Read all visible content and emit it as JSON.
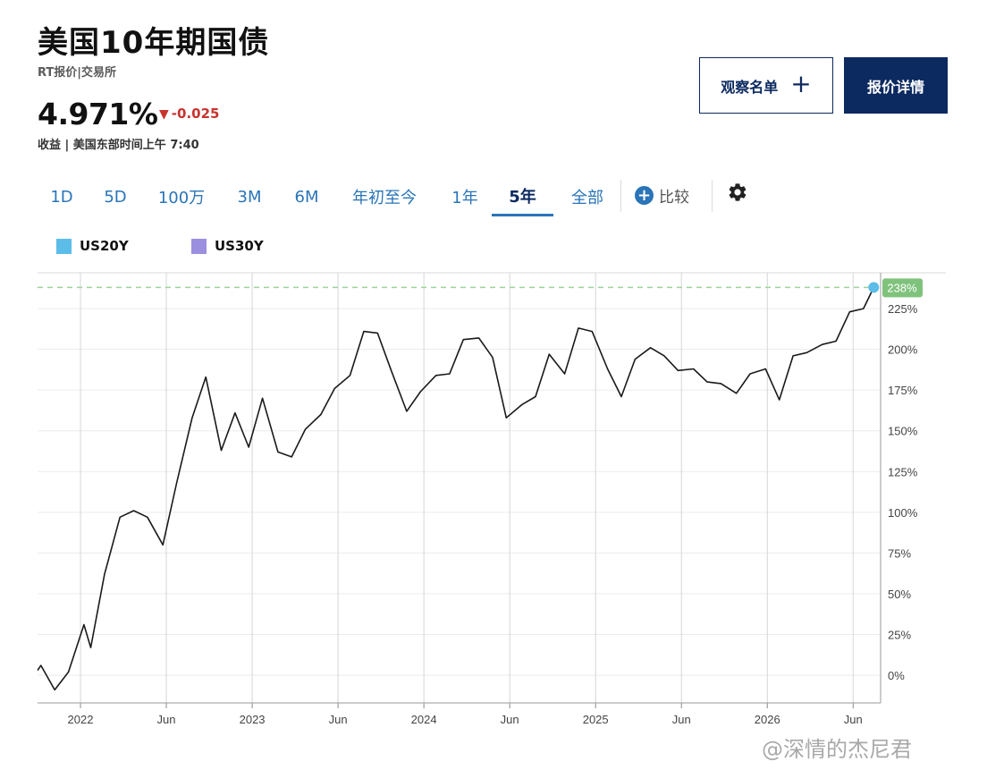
{
  "header": {
    "title": "美国10年期国债",
    "subtitle": "RT报价|交易所",
    "price": "4.971%",
    "change_arrow": "▼",
    "change": "-0.025",
    "yield_note": "收益 | 美国东部时间上午 7:40"
  },
  "buttons": {
    "watchlist_label": "观察名单",
    "watchlist_plus": "+",
    "quote_label": "报价详情"
  },
  "tabs": [
    {
      "label": "1D"
    },
    {
      "label": "5D"
    },
    {
      "label": "100万"
    },
    {
      "label": "3M"
    },
    {
      "label": "6M"
    },
    {
      "label": "年初至今"
    },
    {
      "label": "1年"
    },
    {
      "label": "5年"
    },
    {
      "label": "全部"
    }
  ],
  "active_tab": "5年",
  "compare": {
    "icon": "plus-circle-icon",
    "label": "比较"
  },
  "settings_icon": "gear-icon",
  "legend": [
    {
      "name": "US20Y",
      "color": "#5bbde8"
    },
    {
      "name": "US30Y",
      "color": "#9b8fe0"
    }
  ],
  "watermark": "@深情的杰尼君",
  "colors": {
    "line": "#1a1a1a",
    "last_badge": "#7fc27c",
    "last_dot": "#5bbde8",
    "dashed": "#9ed39a",
    "grid": "#ebebeb",
    "vgrid": "#d6d6d6",
    "tab_active": "#0c2a60",
    "tab": "#2a74b8",
    "down": "#c8332e"
  },
  "chart_data": {
    "type": "line",
    "xlabel": "",
    "ylabel": "",
    "x_range": [
      2021.75,
      2026.66
    ],
    "ylim": [
      -17,
      247
    ],
    "y_ticks": [
      0,
      25,
      50,
      75,
      100,
      125,
      150,
      175,
      200,
      225
    ],
    "y_tick_labels": [
      "0%",
      "25%",
      "50%",
      "75%",
      "100%",
      "125%",
      "150%",
      "175%",
      "200%",
      "225%"
    ],
    "x_ticks": [
      {
        "x": 2022.0,
        "label": "2022"
      },
      {
        "x": 2022.5,
        "label": "Jun"
      },
      {
        "x": 2023.0,
        "label": "2023"
      },
      {
        "x": 2023.5,
        "label": "Jun"
      },
      {
        "x": 2024.0,
        "label": "2024"
      },
      {
        "x": 2024.5,
        "label": "Jun"
      },
      {
        "x": 2025.0,
        "label": "2025"
      },
      {
        "x": 2025.5,
        "label": "Jun"
      },
      {
        "x": 2026.0,
        "label": "2026"
      },
      {
        "x": 2026.5,
        "label": "Jun"
      }
    ],
    "last_value": 238,
    "last_value_label": "238%",
    "grid": true,
    "series": [
      {
        "color": "#1a1a1a",
        "x": [
          2021.75,
          2021.77,
          2021.85,
          2021.93,
          2022.02,
          2022.06,
          2022.14,
          2022.23,
          2022.31,
          2022.39,
          2022.48,
          2022.56,
          2022.65,
          2022.73,
          2022.82,
          2022.9,
          2022.98,
          2023.06,
          2023.15,
          2023.23,
          2023.31,
          2023.4,
          2023.48,
          2023.57,
          2023.65,
          2023.73,
          2023.81,
          2023.9,
          2023.98,
          2024.07,
          2024.15,
          2024.23,
          2024.32,
          2024.4,
          2024.48,
          2024.57,
          2024.65,
          2024.73,
          2024.82,
          2024.9,
          2024.98,
          2025.07,
          2025.15,
          2025.23,
          2025.32,
          2025.4,
          2025.48,
          2025.57,
          2025.65,
          2025.73,
          2025.82,
          2025.9,
          2025.99,
          2026.07,
          2026.15,
          2026.23,
          2026.32,
          2026.4,
          2026.48,
          2026.56,
          2026.62
        ],
        "y": [
          3,
          6,
          -9,
          2,
          31,
          17,
          62,
          97,
          101,
          97,
          80,
          118,
          158,
          183,
          138,
          161,
          140,
          170,
          137,
          134,
          151,
          160,
          176,
          184,
          211,
          210,
          187,
          162,
          174,
          184,
          185,
          206,
          207,
          195,
          158,
          166,
          171,
          197,
          185,
          213,
          211,
          188,
          171,
          194,
          201,
          196,
          187,
          188,
          180,
          179,
          173,
          185,
          188,
          169,
          196,
          198,
          203,
          205,
          223,
          225,
          238
        ]
      }
    ]
  }
}
